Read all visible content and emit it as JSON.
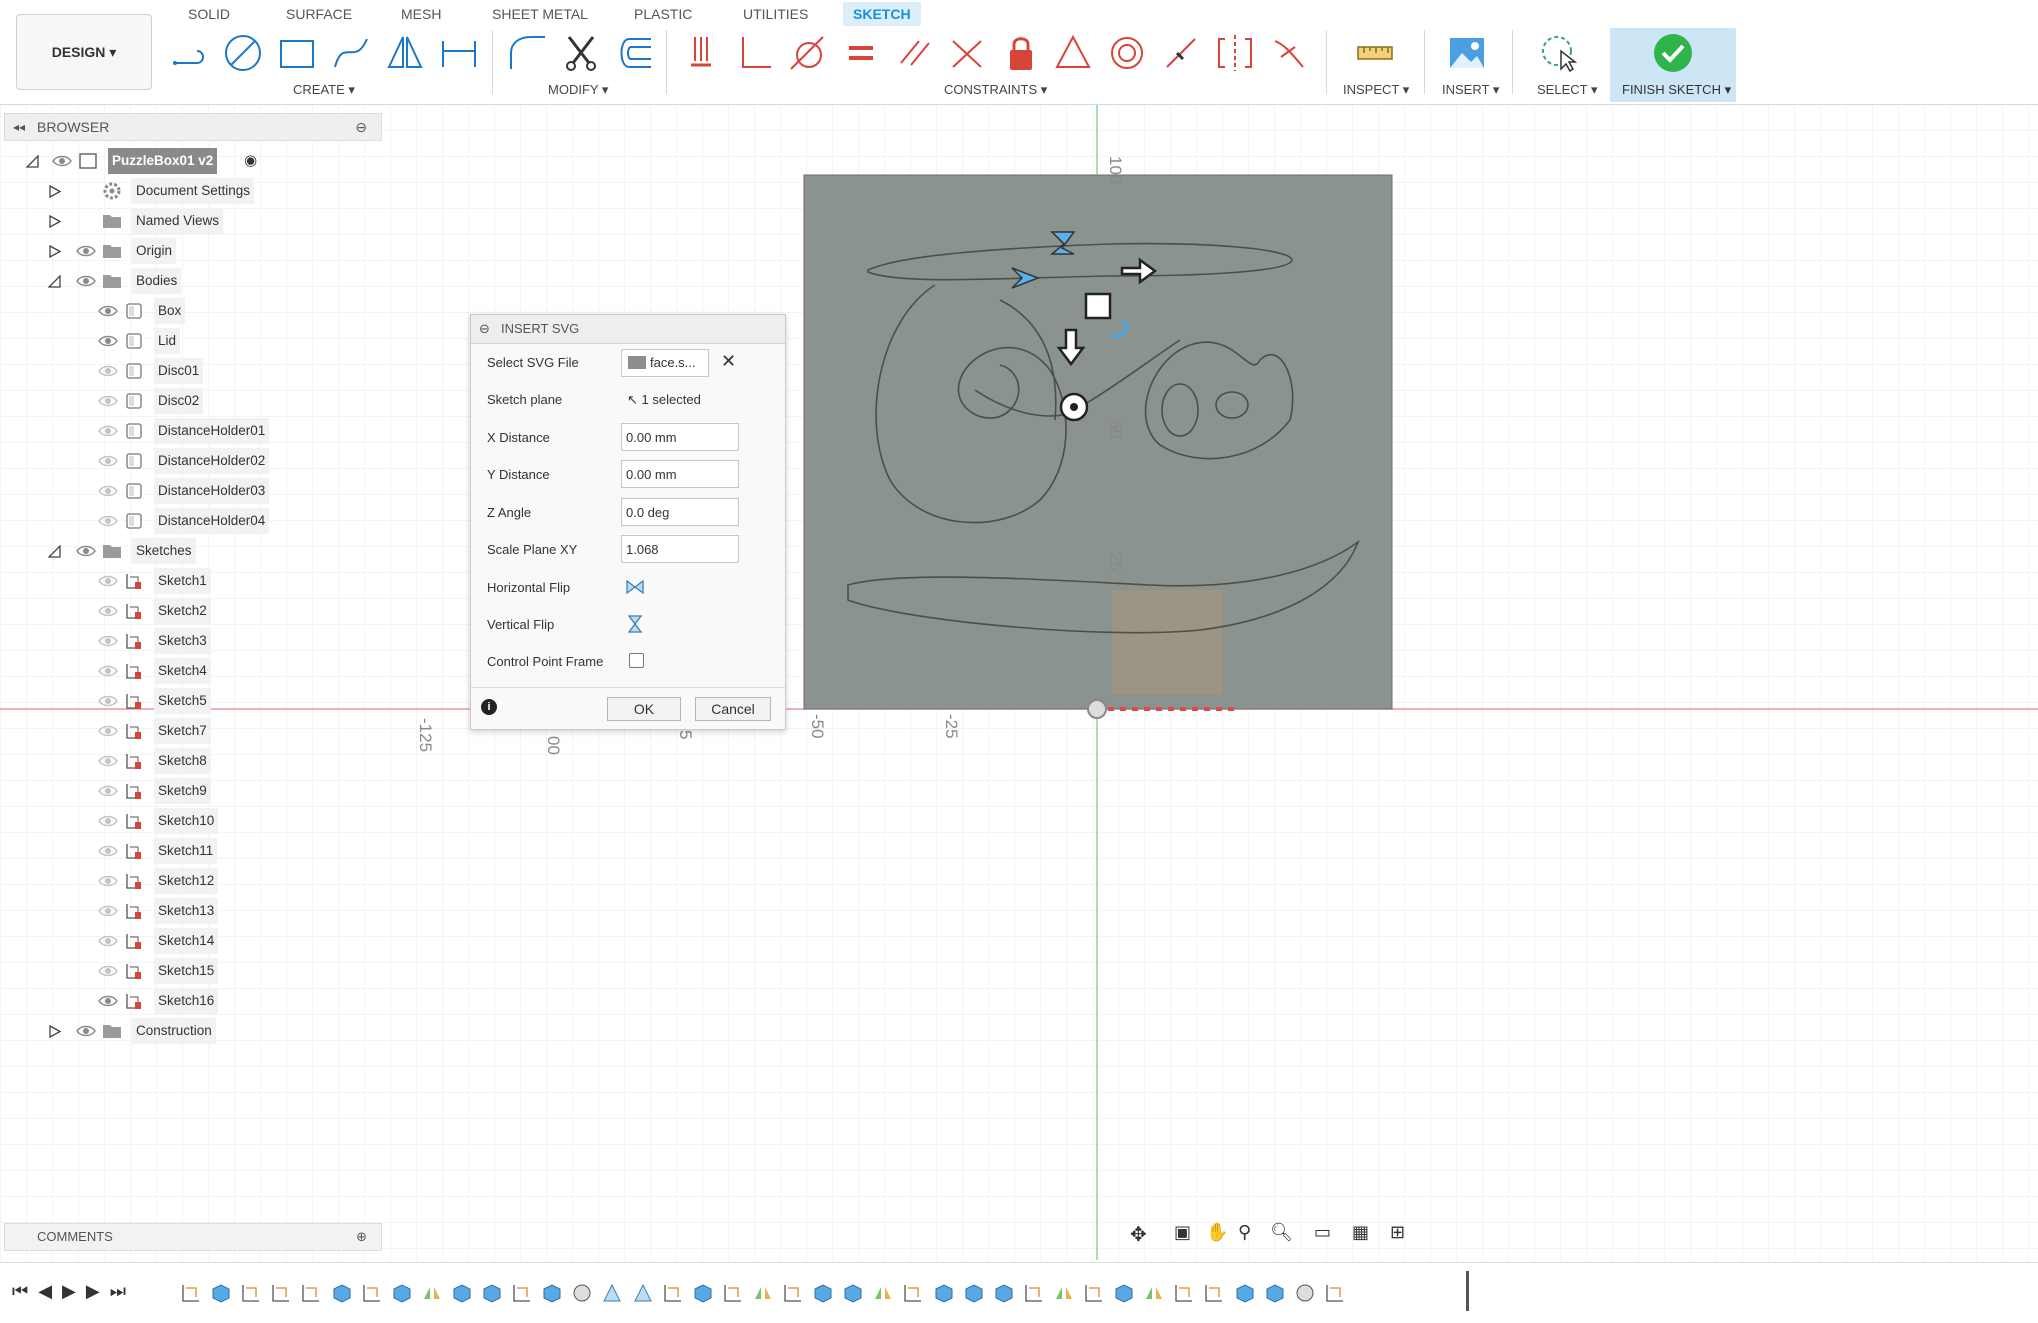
{
  "workspace": {
    "label": "DESIGN ▾"
  },
  "tabs": [
    {
      "label": "SOLID"
    },
    {
      "label": "SURFACE"
    },
    {
      "label": "MESH"
    },
    {
      "label": "SHEET METAL"
    },
    {
      "label": "PLASTIC"
    },
    {
      "label": "UTILITIES"
    },
    {
      "label": "SKETCH",
      "active": true
    }
  ],
  "groups": {
    "create": "CREATE ▾",
    "modify": "MODIFY ▾",
    "constraints": "CONSTRAINTS ▾",
    "inspect": "INSPECT ▾",
    "insert": "INSERT ▾",
    "select": "SELECT ▾",
    "finish": "FINISH SKETCH ▾"
  },
  "browser": {
    "title": "BROWSER",
    "root": "PuzzleBox01 v2",
    "items": [
      {
        "label": "Document Settings"
      },
      {
        "label": "Named Views"
      },
      {
        "label": "Origin"
      },
      {
        "label": "Bodies"
      },
      {
        "label": "Box"
      },
      {
        "label": "Lid"
      },
      {
        "label": "Disc01"
      },
      {
        "label": "Disc02"
      },
      {
        "label": "DistanceHolder01"
      },
      {
        "label": "DistanceHolder02"
      },
      {
        "label": "DistanceHolder03"
      },
      {
        "label": "DistanceHolder04"
      },
      {
        "label": "Sketches"
      },
      {
        "label": "Sketch1"
      },
      {
        "label": "Sketch2"
      },
      {
        "label": "Sketch3"
      },
      {
        "label": "Sketch4"
      },
      {
        "label": "Sketch5"
      },
      {
        "label": "Sketch7"
      },
      {
        "label": "Sketch8"
      },
      {
        "label": "Sketch9"
      },
      {
        "label": "Sketch10"
      },
      {
        "label": "Sketch11"
      },
      {
        "label": "Sketch12"
      },
      {
        "label": "Sketch13"
      },
      {
        "label": "Sketch14"
      },
      {
        "label": "Sketch15"
      },
      {
        "label": "Sketch16"
      },
      {
        "label": "Construction"
      }
    ]
  },
  "dialog": {
    "title": "INSERT SVG",
    "select_svg_label": "Select SVG File",
    "file_value": "face.s...",
    "sketch_plane_label": "Sketch plane",
    "sketch_plane_value": "1 selected",
    "x_distance_label": "X Distance",
    "x_distance": "0.00 mm",
    "y_distance_label": "Y Distance",
    "y_distance": "0.00 mm",
    "z_angle_label": "Z Angle",
    "z_angle": "0.0 deg",
    "scale_label": "Scale Plane XY",
    "scale": "1.068",
    "hflip_label": "Horizontal Flip",
    "vflip_label": "Vertical Flip",
    "cpf_label": "Control Point Frame",
    "ok": "OK",
    "cancel": "Cancel"
  },
  "rulers": {
    "v100": "100",
    "v50": "50",
    "v25": "25",
    "h_125": "-125",
    "h_00": "00",
    "h_5": "5",
    "h_50": "-50",
    "h_25": "-25"
  },
  "comments": {
    "label": "COMMENTS"
  },
  "colors": {
    "accent": "#1b8de0",
    "sketch_plane": "#8b938e",
    "axis_x": "#e04a4a",
    "axis_y": "#6fcf6f"
  }
}
